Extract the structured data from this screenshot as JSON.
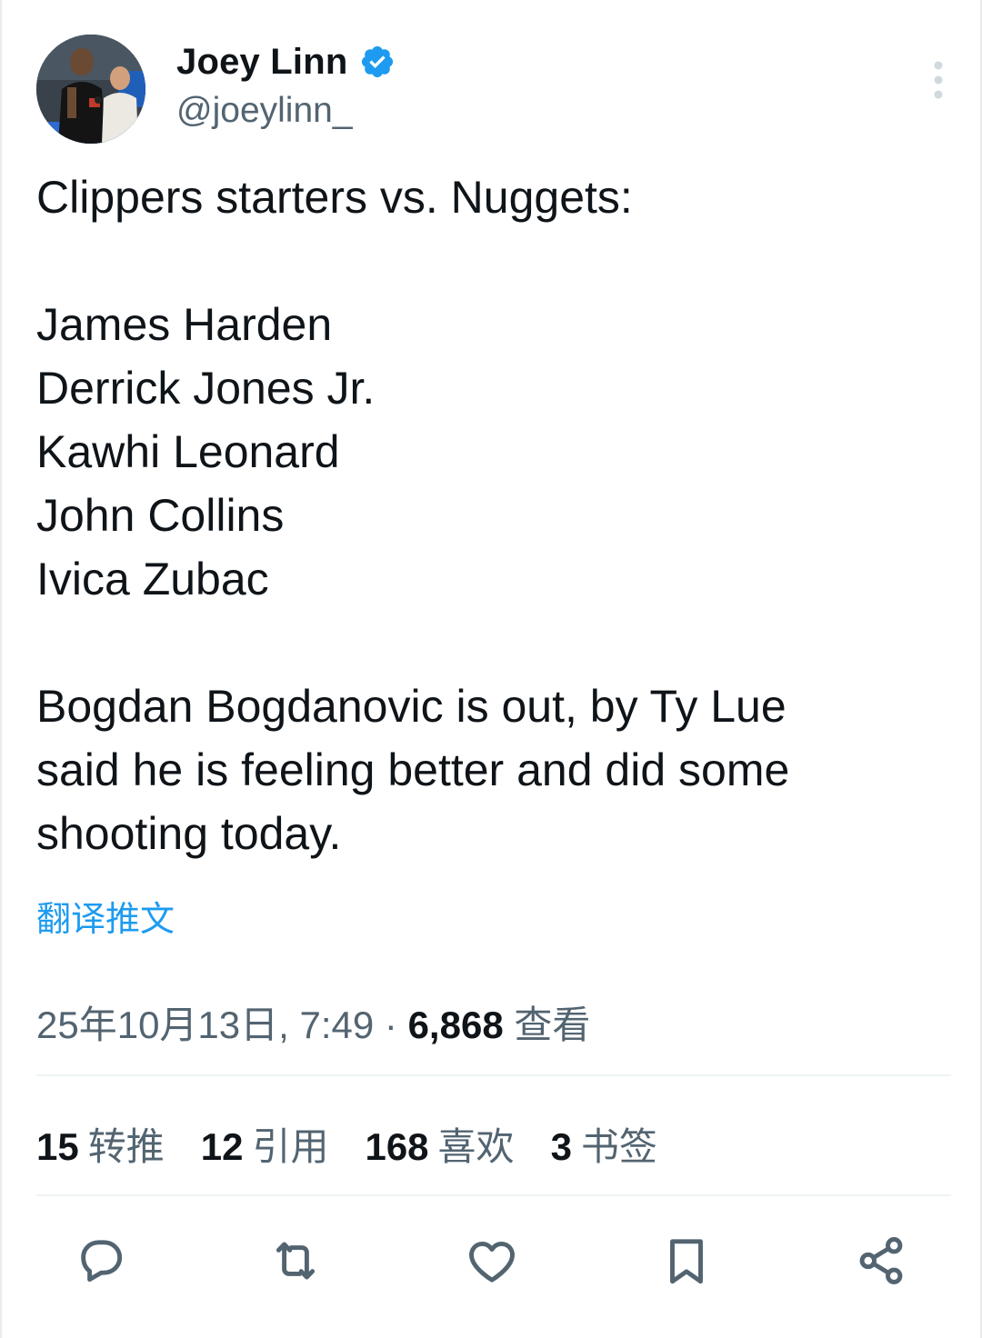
{
  "author": {
    "display_name": "Joey Linn",
    "handle": "@joeylinn_",
    "verified": true,
    "avatar": "avatar-photo-two-men"
  },
  "tweet": {
    "lines": [
      "Clippers starters vs. Nuggets:",
      "",
      "James Harden",
      "Derrick Jones Jr.",
      "Kawhi Leonard",
      "John Collins",
      "Ivica Zubac",
      "",
      "Bogdan Bogdanovic is out, by Ty Lue",
      "said he is feeling better and did some",
      "shooting today."
    ],
    "translate_label": "翻译推文"
  },
  "meta": {
    "timestamp": "25年10月13日, 7:49",
    "separator": "·",
    "views_count": "6,868",
    "views_label": "查看"
  },
  "stats": [
    {
      "count": "15",
      "label": "转推"
    },
    {
      "count": "12",
      "label": "引用"
    },
    {
      "count": "168",
      "label": "喜欢"
    },
    {
      "count": "3",
      "label": "书签"
    }
  ],
  "actions": [
    {
      "name": "reply",
      "icon": "reply-icon"
    },
    {
      "name": "retweet",
      "icon": "retweet-icon"
    },
    {
      "name": "like",
      "icon": "heart-icon"
    },
    {
      "name": "bookmark",
      "icon": "bookmark-icon"
    },
    {
      "name": "share",
      "icon": "share-icon"
    }
  ],
  "colors": {
    "accent": "#1d9bf0",
    "text": "#0f1419",
    "secondary": "#536471"
  }
}
